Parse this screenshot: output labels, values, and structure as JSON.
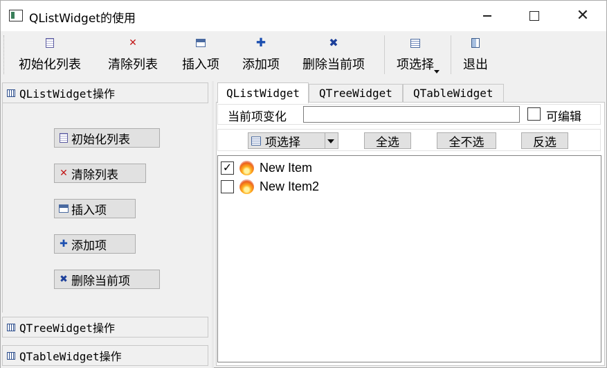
{
  "window": {
    "title": "QListWidget的使用",
    "minimize_icon": "minimize-icon",
    "maximize_icon": "maximize-icon",
    "close_glyph": "✕"
  },
  "toolbar": {
    "items": [
      {
        "label": "初始化列表",
        "icon": "init-list-icon"
      },
      {
        "label": "清除列表",
        "icon": "clear-list-icon"
      },
      {
        "label": "插入项",
        "icon": "insert-item-icon"
      },
      {
        "label": "添加项",
        "icon": "add-item-icon"
      },
      {
        "label": "删除当前项",
        "icon": "delete-item-icon"
      },
      {
        "label": "项选择",
        "icon": "select-items-icon"
      },
      {
        "label": "退出",
        "icon": "exit-icon"
      }
    ]
  },
  "toolbox": {
    "pages": [
      {
        "title": "QListWidget操作"
      },
      {
        "title": "QTreeWidget操作"
      },
      {
        "title": "QTableWidget操作"
      }
    ],
    "buttons": [
      {
        "label": "初始化列表"
      },
      {
        "label": "清除列表"
      },
      {
        "label": "插入项"
      },
      {
        "label": "添加项"
      },
      {
        "label": "删除当前项"
      }
    ]
  },
  "tabs": [
    {
      "label": "QListWidget"
    },
    {
      "label": "QTreeWidget"
    },
    {
      "label": "QTableWidget"
    }
  ],
  "current_item": {
    "label": "当前项变化",
    "value": "",
    "editable_label": "可编辑",
    "editable_checked": false
  },
  "selection": {
    "dropdown_label": "项选择",
    "select_all": "全选",
    "select_none": "全不选",
    "invert": "反选"
  },
  "list_items": [
    {
      "text": "New Item",
      "checked": true
    },
    {
      "text": "New Item2",
      "checked": false
    }
  ],
  "colors": {
    "accent_red": "#c21818",
    "accent_blue": "#1c4fb0"
  }
}
